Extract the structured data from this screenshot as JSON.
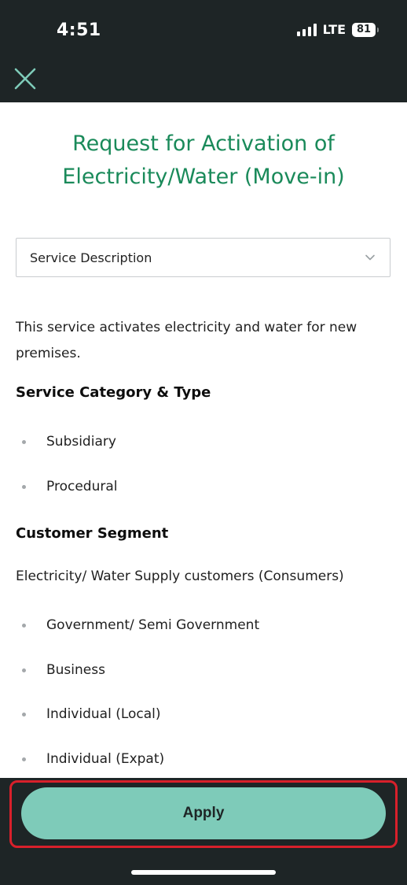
{
  "status_bar": {
    "time": "4:51",
    "network": "LTE",
    "battery": "81"
  },
  "header": {
    "close_icon": "close-icon"
  },
  "page": {
    "title": "Request for Activation of Electricity/Water (Move-in)"
  },
  "dropdown": {
    "label": "Service Description",
    "icon": "chevron-down-icon"
  },
  "description": "This service activates electricity and water for new premises.",
  "sections": {
    "category": {
      "heading": "Service Category & Type",
      "items": [
        "Subsidiary",
        "Procedural"
      ]
    },
    "segment": {
      "heading": "Customer Segment",
      "subtitle": "Electricity/ Water Supply customers (Consumers)",
      "items": [
        "Government/ Semi Government",
        "Business",
        "Individual (Local)",
        "Individual (Expat)"
      ]
    }
  },
  "footer": {
    "apply_label": "Apply"
  },
  "colors": {
    "accent": "#1a8a5a",
    "button": "#7ecbb9",
    "dark": "#1e2526",
    "highlight": "#d8202b"
  }
}
